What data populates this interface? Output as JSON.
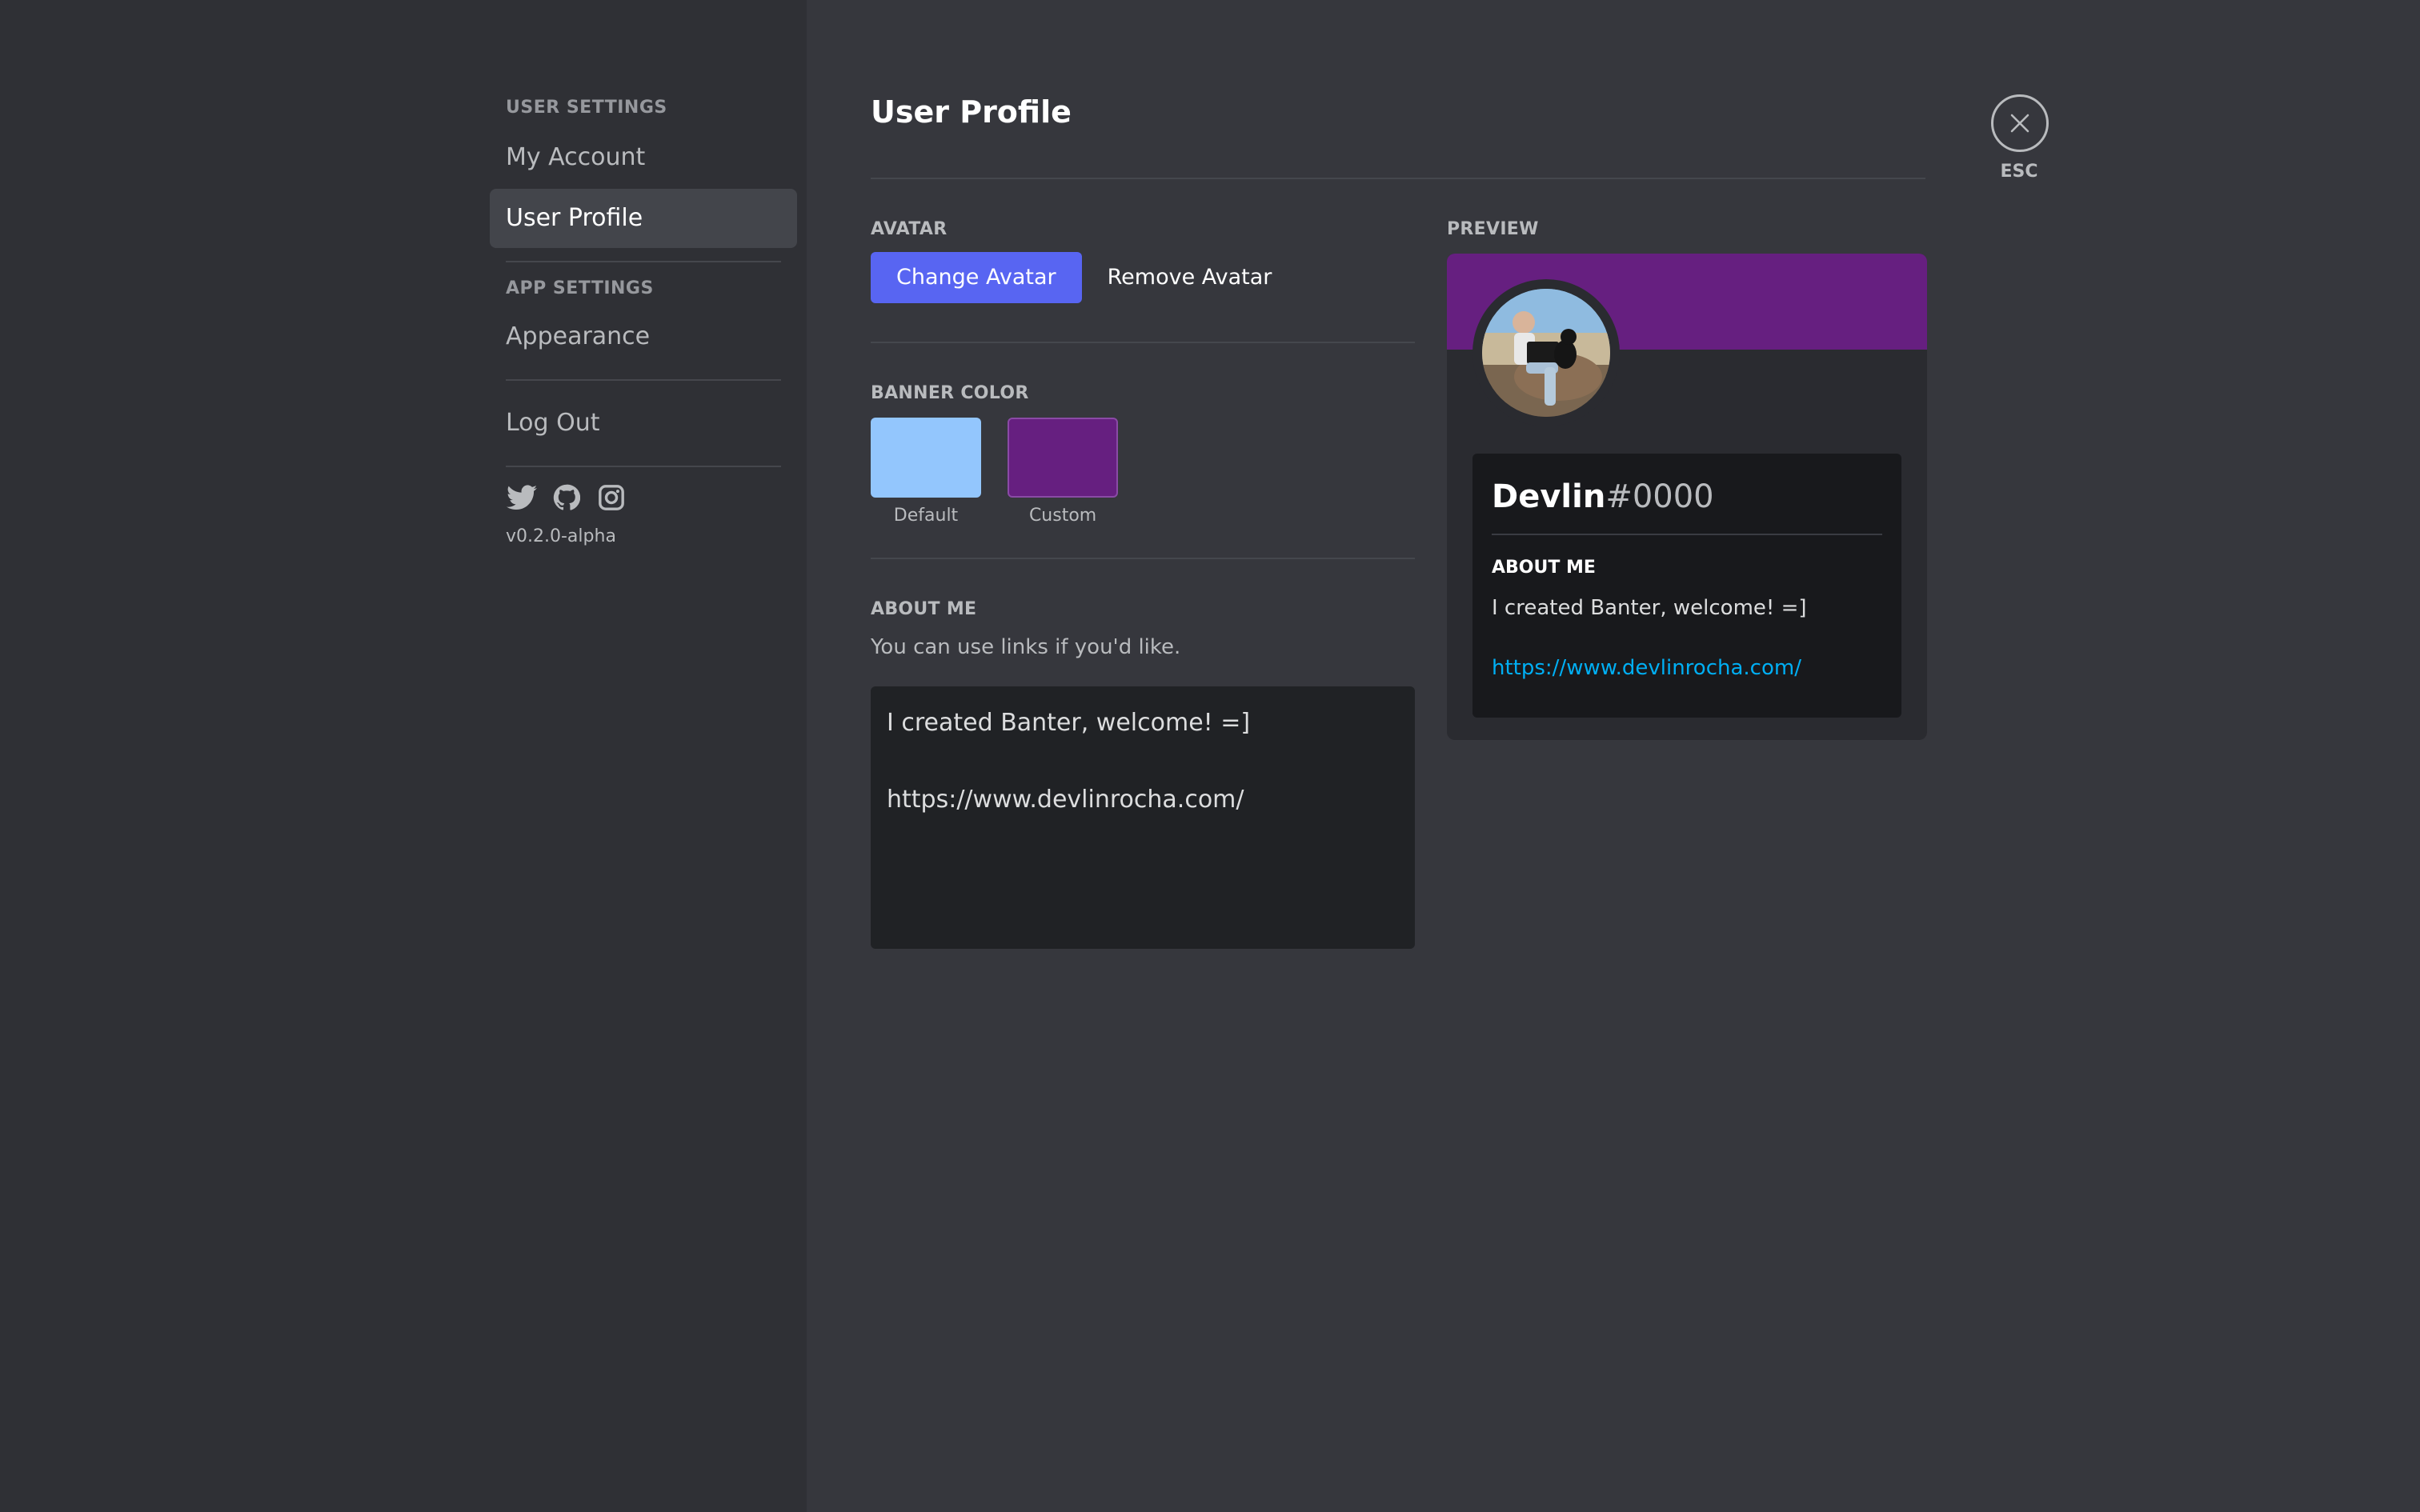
{
  "sidebar": {
    "user_settings_heading": "USER SETTINGS",
    "items_user": [
      {
        "label": "My Account"
      },
      {
        "label": "User Profile",
        "active": true
      }
    ],
    "app_settings_heading": "APP SETTINGS",
    "items_app": [
      {
        "label": "Appearance"
      }
    ],
    "logout_label": "Log Out",
    "social_icons": [
      "twitter-icon",
      "github-icon",
      "instagram-icon"
    ],
    "version": "v0.2.0-alpha"
  },
  "main": {
    "title": "User Profile",
    "avatar_section": {
      "label": "AVATAR",
      "change_label": "Change Avatar",
      "remove_label": "Remove Avatar"
    },
    "banner_section": {
      "label": "BANNER COLOR",
      "swatches": [
        {
          "label": "Default",
          "color": "#93c6fd"
        },
        {
          "label": "Custom",
          "color": "#661f80"
        }
      ]
    },
    "about_section": {
      "label": "ABOUT ME",
      "hint": "You can use links if you'd like.",
      "value": "I created Banter, welcome! =]\n\nhttps://www.devlinrocha.com/"
    },
    "preview": {
      "label": "PREVIEW",
      "banner_color": "#661f80",
      "username": "Devlin",
      "tag": "#0000",
      "about_label": "ABOUT ME",
      "about_text": "I created Banter, welcome! =]",
      "about_link": "https://www.devlinrocha.com/"
    }
  },
  "close": {
    "esc_label": "ESC"
  },
  "colors": {
    "accent": "#5865f2",
    "link": "#00aff4"
  }
}
